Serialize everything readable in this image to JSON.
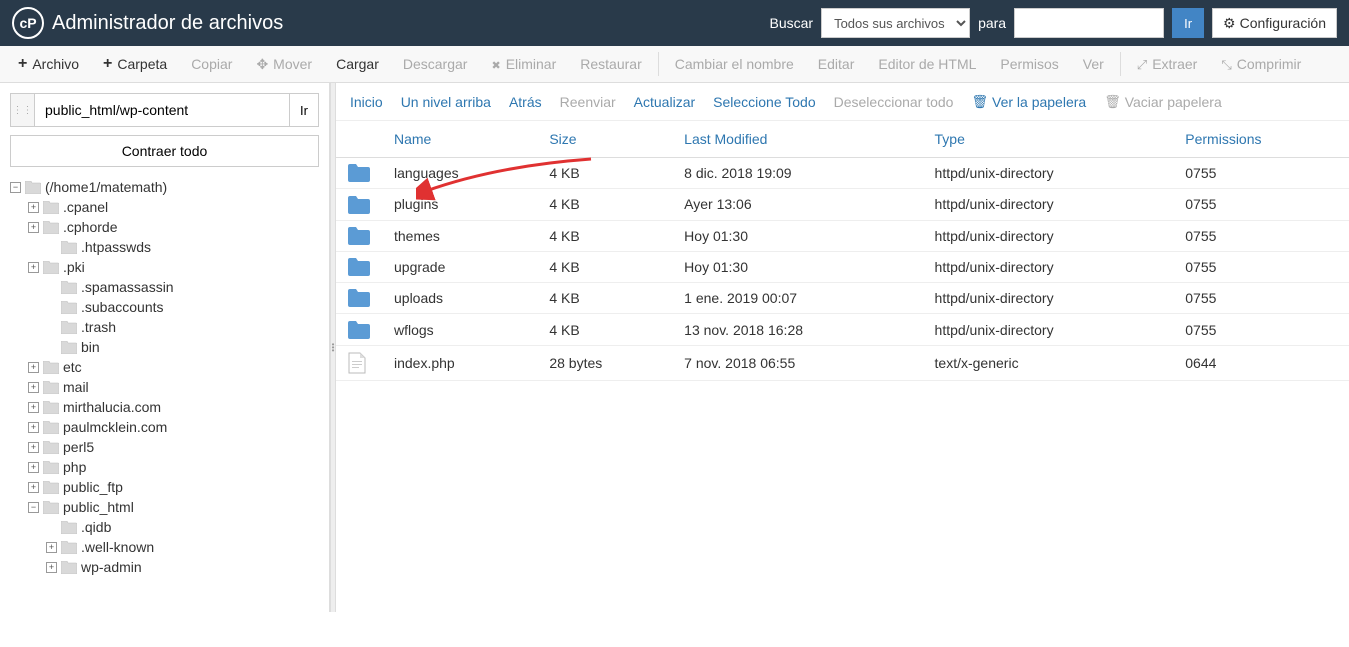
{
  "header": {
    "title": "Administrador de archivos",
    "search_label": "Buscar",
    "search_scope": "Todos sus archivos",
    "for_label": "para",
    "go_label": "Ir",
    "config_label": "Configuración"
  },
  "toolbar": {
    "file": "Archivo",
    "folder": "Carpeta",
    "copy": "Copiar",
    "move": "Mover",
    "upload": "Cargar",
    "download": "Descargar",
    "delete": "Eliminar",
    "restore": "Restaurar",
    "rename": "Cambiar el nombre",
    "edit": "Editar",
    "html_editor": "Editor de HTML",
    "permissions": "Permisos",
    "view": "Ver",
    "extract": "Extraer",
    "compress": "Comprimir"
  },
  "sidebar": {
    "path": "public_html/wp-content",
    "go": "Ir",
    "collapse": "Contraer todo",
    "root": "(/home1/matemath)",
    "nodes": [
      {
        "label": ".cpanel",
        "expandable": true,
        "depth": 1
      },
      {
        "label": ".cphorde",
        "expandable": true,
        "depth": 1
      },
      {
        "label": ".htpasswds",
        "expandable": false,
        "depth": 2
      },
      {
        "label": ".pki",
        "expandable": true,
        "depth": 1
      },
      {
        "label": ".spamassassin",
        "expandable": false,
        "depth": 2
      },
      {
        "label": ".subaccounts",
        "expandable": false,
        "depth": 2
      },
      {
        "label": ".trash",
        "expandable": false,
        "depth": 2
      },
      {
        "label": "bin",
        "expandable": false,
        "depth": 2
      },
      {
        "label": "etc",
        "expandable": true,
        "depth": 1
      },
      {
        "label": "mail",
        "expandable": true,
        "depth": 1
      },
      {
        "label": "mirthalucia.com",
        "expandable": true,
        "depth": 1
      },
      {
        "label": "paulmcklein.com",
        "expandable": true,
        "depth": 1
      },
      {
        "label": "perl5",
        "expandable": true,
        "depth": 1
      },
      {
        "label": "php",
        "expandable": true,
        "depth": 1
      },
      {
        "label": "public_ftp",
        "expandable": true,
        "depth": 1
      },
      {
        "label": "public_html",
        "expandable": true,
        "depth": 1,
        "open": true
      },
      {
        "label": ".qidb",
        "expandable": false,
        "depth": 2
      },
      {
        "label": ".well-known",
        "expandable": true,
        "depth": 2
      },
      {
        "label": "wp-admin",
        "expandable": true,
        "depth": 2
      }
    ]
  },
  "content_toolbar": {
    "home": "Inicio",
    "up": "Un nivel arriba",
    "back": "Atrás",
    "forward": "Reenviar",
    "refresh": "Actualizar",
    "select_all": "Seleccione Todo",
    "deselect_all": "Deseleccionar todo",
    "view_trash": "Ver la papelera",
    "empty_trash": "Vaciar papelera"
  },
  "table": {
    "headers": {
      "name": "Name",
      "size": "Size",
      "modified": "Last Modified",
      "type": "Type",
      "permissions": "Permissions"
    },
    "rows": [
      {
        "name": "languages",
        "size": "4 KB",
        "modified": "8 dic. 2018 19:09",
        "type": "httpd/unix-directory",
        "permissions": "0755",
        "icon": "folder"
      },
      {
        "name": "plugins",
        "size": "4 KB",
        "modified": "Ayer 13:06",
        "type": "httpd/unix-directory",
        "permissions": "0755",
        "icon": "folder"
      },
      {
        "name": "themes",
        "size": "4 KB",
        "modified": "Hoy 01:30",
        "type": "httpd/unix-directory",
        "permissions": "0755",
        "icon": "folder"
      },
      {
        "name": "upgrade",
        "size": "4 KB",
        "modified": "Hoy 01:30",
        "type": "httpd/unix-directory",
        "permissions": "0755",
        "icon": "folder"
      },
      {
        "name": "uploads",
        "size": "4 KB",
        "modified": "1 ene. 2019 00:07",
        "type": "httpd/unix-directory",
        "permissions": "0755",
        "icon": "folder"
      },
      {
        "name": "wflogs",
        "size": "4 KB",
        "modified": "13 nov. 2018 16:28",
        "type": "httpd/unix-directory",
        "permissions": "0755",
        "icon": "folder"
      },
      {
        "name": "index.php",
        "size": "28 bytes",
        "modified": "7 nov. 2018 06:55",
        "type": "text/x-generic",
        "permissions": "0644",
        "icon": "file"
      }
    ]
  }
}
